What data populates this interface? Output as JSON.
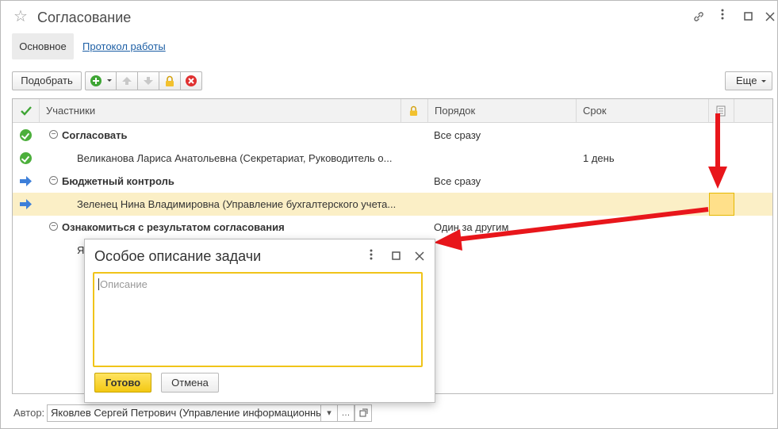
{
  "window": {
    "title": "Согласование"
  },
  "tabs": {
    "main": "Основное",
    "log": "Протокол работы"
  },
  "toolbar": {
    "pick": "Подобрать",
    "more": "Еще"
  },
  "table": {
    "headers": {
      "participants": "Участники",
      "order": "Порядок",
      "term": "Срок"
    },
    "rows": [
      {
        "status": "done",
        "group": true,
        "participant": "Согласовать",
        "order": "Все сразу",
        "term": ""
      },
      {
        "status": "done",
        "group": false,
        "participant": "Великанова Лариса Анатольевна (Секретариат, Руководитель о...",
        "order": "",
        "term": "1 день"
      },
      {
        "status": "current",
        "group": true,
        "participant": "Бюджетный контроль",
        "order": "Все сразу",
        "term": ""
      },
      {
        "status": "current",
        "group": false,
        "participant": "Зеленец Нина Владимировна (Управление бухгалтерского учета...",
        "order": "",
        "term": ""
      },
      {
        "status": "none",
        "group": true,
        "participant": "Ознакомиться с результатом согласования",
        "order": "Один за другим",
        "term": ""
      },
      {
        "status": "none",
        "group": false,
        "participant": "Я",
        "order": "",
        "term": ""
      }
    ]
  },
  "author": {
    "label": "Автор:",
    "value": "Яковлев Сергей Петрович (Управление информационных"
  },
  "dialog": {
    "title": "Особое описание задачи",
    "placeholder": "Описание",
    "ok": "Готово",
    "cancel": "Отмена"
  },
  "colors": {
    "accent_yellow": "#f3c813",
    "selected_row": "#fbefc6",
    "arrow_red": "#e8161b",
    "status_green": "#4caf3c",
    "status_blue": "#3d7fd9",
    "link_blue": "#1d5fa5"
  }
}
